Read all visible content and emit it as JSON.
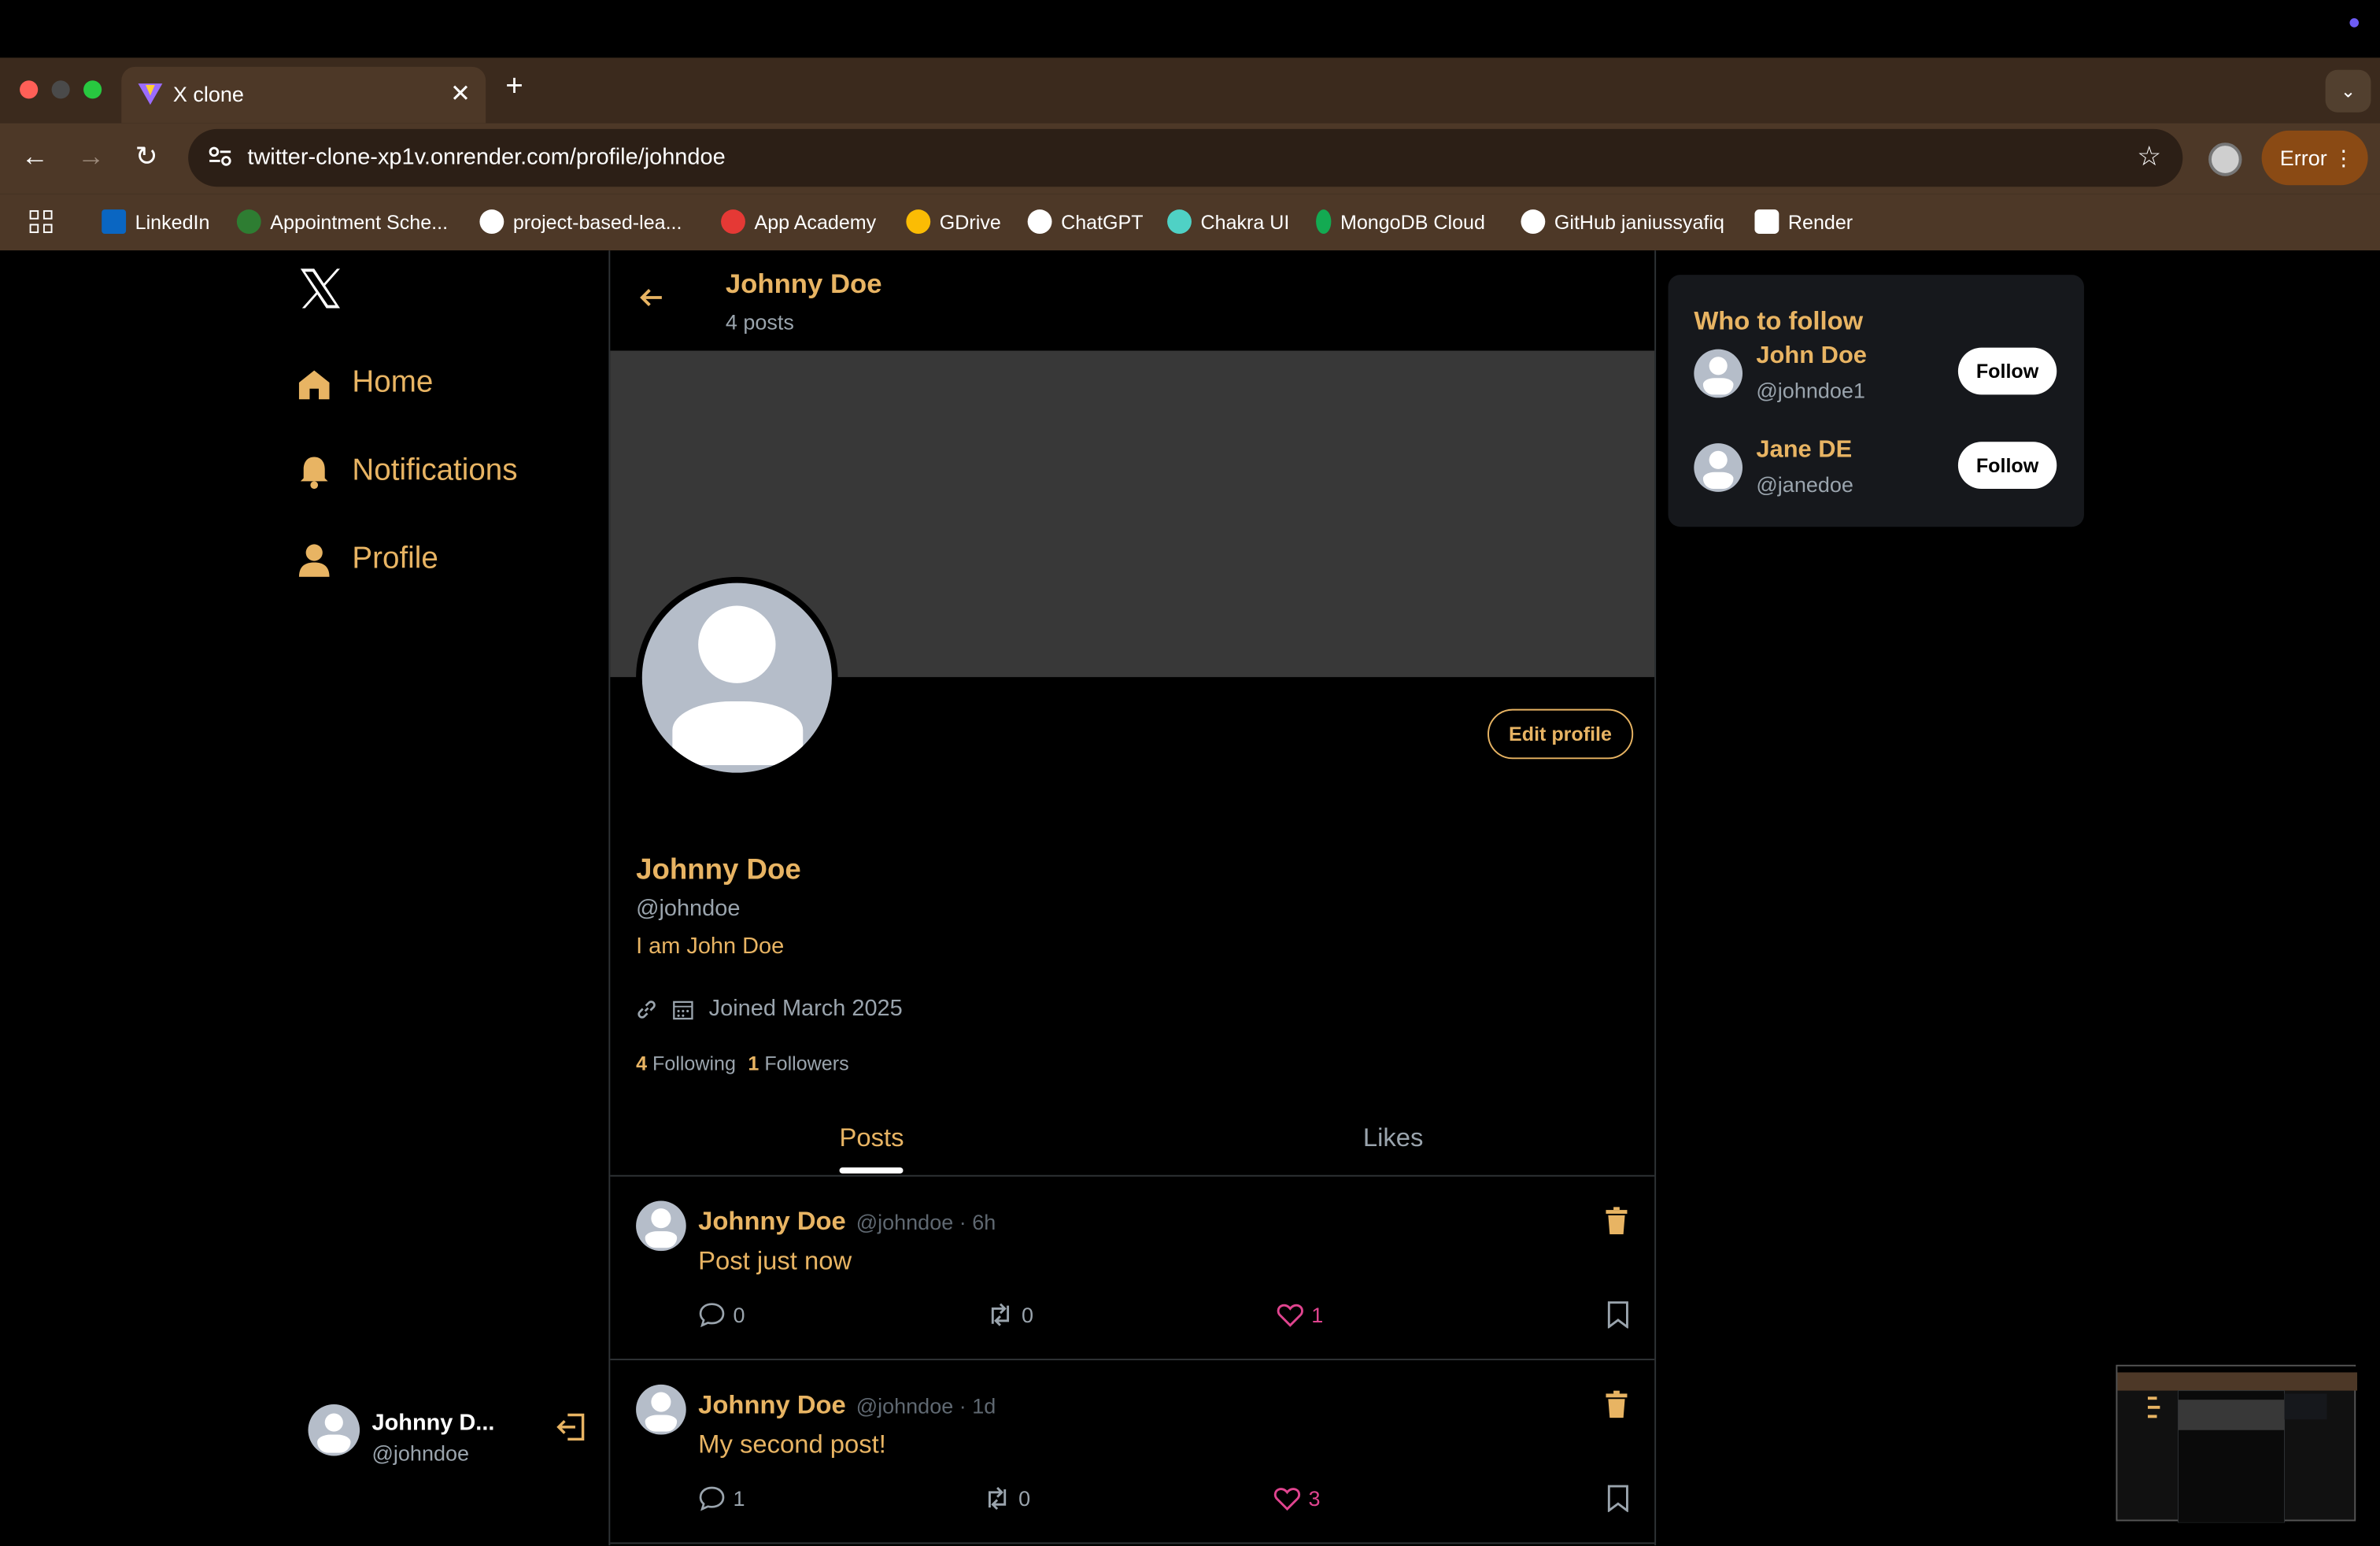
{
  "browser": {
    "tab_title": "X clone",
    "url": "twitter-clone-xp1v.onrender.com/profile/johndoe",
    "error_label": "Error",
    "bookmarks": [
      {
        "label": "LinkedIn",
        "color": "#0a66c2"
      },
      {
        "label": "Appointment Sche...",
        "color": "#2e7d32"
      },
      {
        "label": "project-based-lea...",
        "color": "#ffffff"
      },
      {
        "label": "App Academy",
        "color": "#e53935"
      },
      {
        "label": "GDrive",
        "color": "#fbbc04"
      },
      {
        "label": "ChatGPT",
        "color": "#ffffff"
      },
      {
        "label": "Chakra UI",
        "color": "#4fd1c5"
      },
      {
        "label": "MongoDB Cloud",
        "color": "#13aa52"
      },
      {
        "label": "GitHub janiussyafiq",
        "color": "#ffffff"
      },
      {
        "label": "Render",
        "color": "#ffffff"
      }
    ]
  },
  "sidebar": {
    "items": [
      {
        "label": "Home",
        "icon": "home-icon"
      },
      {
        "label": "Notifications",
        "icon": "bell-icon"
      },
      {
        "label": "Profile",
        "icon": "user-icon"
      }
    ],
    "me": {
      "name": "Johnny D...",
      "handle": "@johndoe"
    }
  },
  "header": {
    "name": "Johnny Doe",
    "posts_count": "4 posts"
  },
  "profile": {
    "edit_label": "Edit profile",
    "name": "Johnny Doe",
    "handle": "@johndoe",
    "bio": "I am John Doe",
    "joined": "Joined March 2025",
    "following_count": "4",
    "following_label": "Following",
    "followers_count": "1",
    "followers_label": "Followers"
  },
  "tabs": {
    "posts": "Posts",
    "likes": "Likes"
  },
  "posts": [
    {
      "name": "Johnny Doe",
      "meta": "@johndoe · 6h",
      "text": "Post just now",
      "comments": "0",
      "reposts": "0",
      "likes": "1"
    },
    {
      "name": "Johnny Doe",
      "meta": "@johndoe · 1d",
      "text": "My second post!",
      "comments": "1",
      "reposts": "0",
      "likes": "3"
    }
  ],
  "who_to_follow": {
    "title": "Who to follow",
    "users": [
      {
        "name": "John Doe",
        "handle": "@johndoe1",
        "button": "Follow"
      },
      {
        "name": "Jane DE",
        "handle": "@janedoe",
        "button": "Follow"
      }
    ]
  },
  "colors": {
    "accent": "#e8b463",
    "like": "#e0448f",
    "muted": "#9aa4ad"
  }
}
